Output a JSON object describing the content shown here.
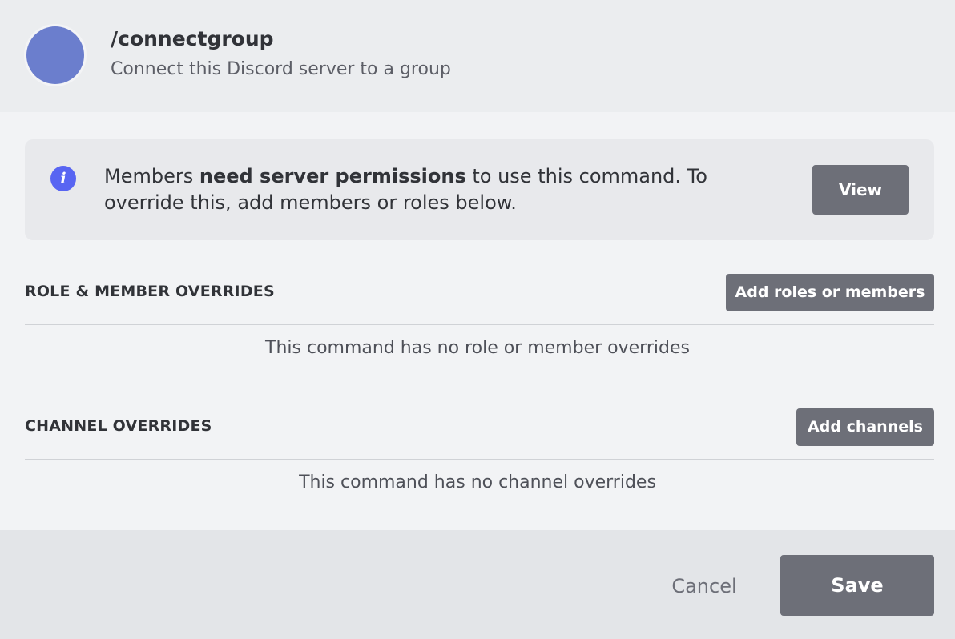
{
  "header": {
    "command_name": "/connectgroup",
    "command_description": "Connect this Discord server to a group",
    "avatar_color": "#6b7ecd"
  },
  "notice": {
    "icon": "info-icon",
    "text_before": "Members ",
    "text_bold": "need server permissions",
    "text_after": " to use this command. To override this, add members or roles below.",
    "view_label": "View"
  },
  "roles_section": {
    "title": "ROLE & MEMBER OVERRIDES",
    "add_label": "Add roles or members",
    "empty_text": "This command has no role or member overrides"
  },
  "channels_section": {
    "title": "CHANNEL OVERRIDES",
    "add_label": "Add channels",
    "empty_text": "This command has no channel overrides"
  },
  "footer": {
    "cancel_label": "Cancel",
    "save_label": "Save"
  },
  "colors": {
    "button_bg": "#6d6f78",
    "accent": "#5865f2"
  }
}
